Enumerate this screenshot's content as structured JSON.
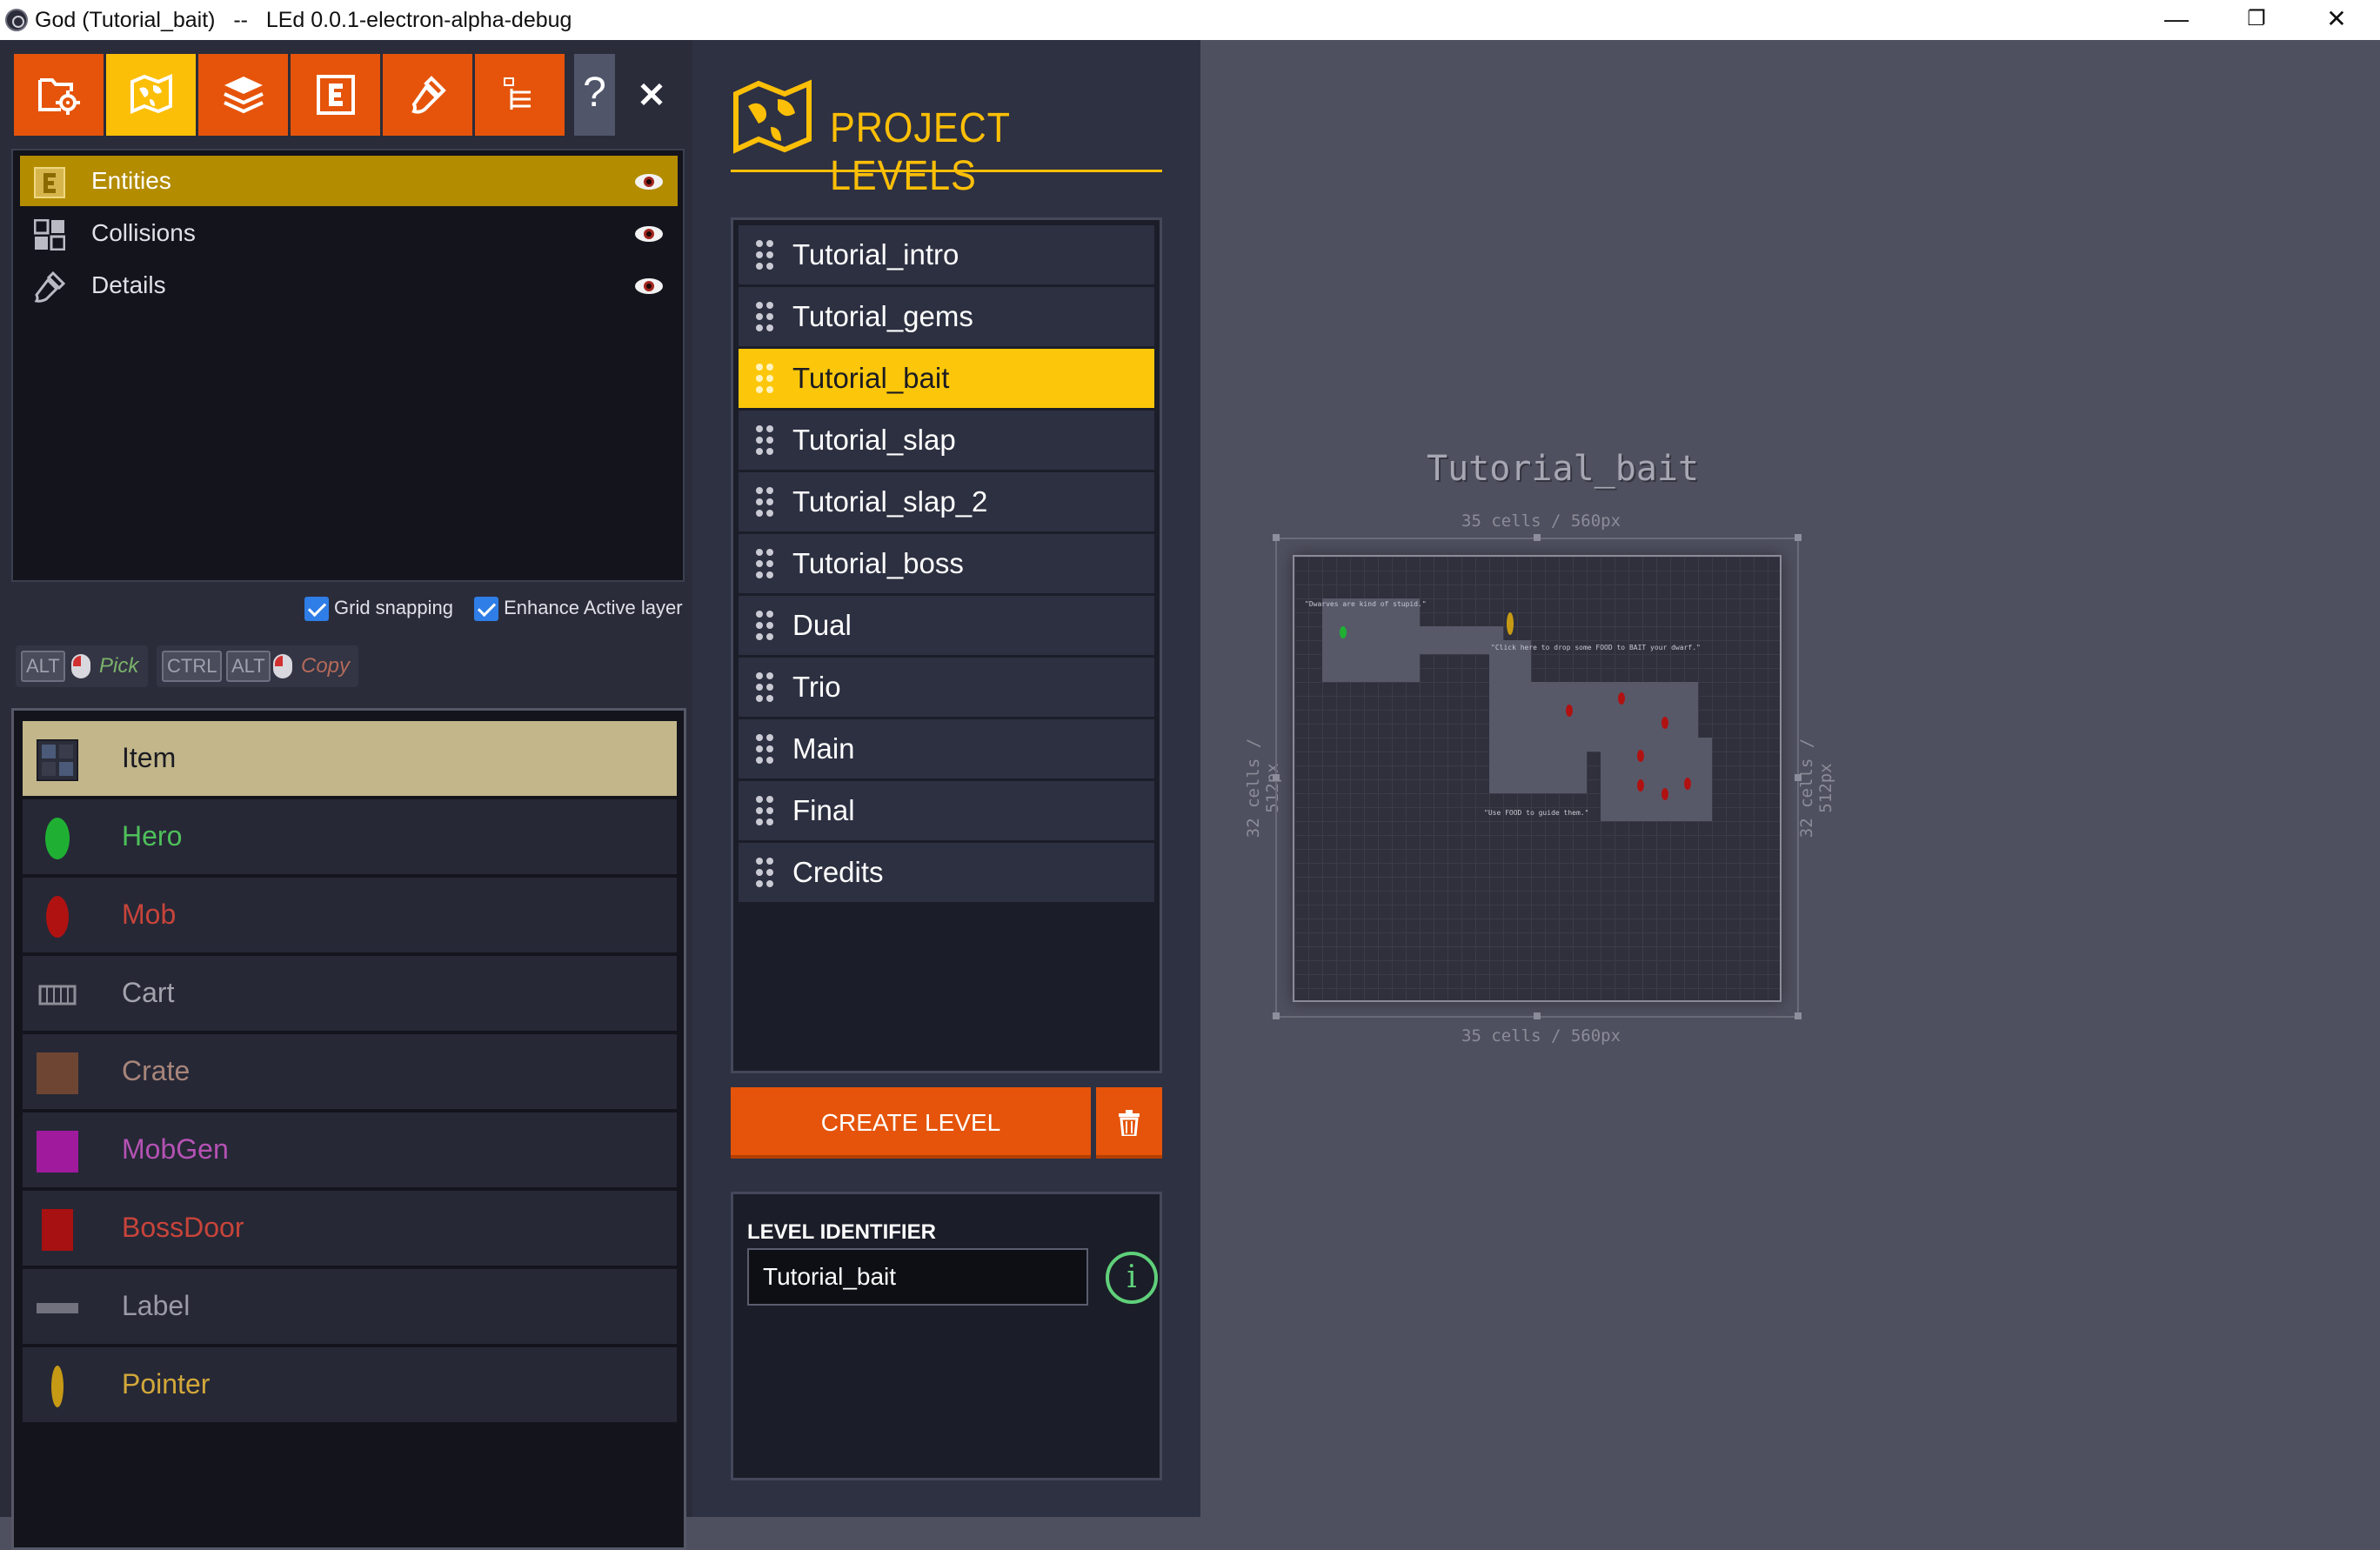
{
  "window": {
    "title": "God (Tutorial_bait)   --   LEd 0.0.1-electron-alpha-debug",
    "controls": [
      "—",
      "❐",
      "✕"
    ]
  },
  "toolbar": {
    "buttons": [
      {
        "name": "project-settings-button",
        "icon": "folder-gear-icon",
        "active": false
      },
      {
        "name": "levels-button",
        "icon": "world-map-icon",
        "active": true
      },
      {
        "name": "layers-button",
        "icon": "layers-stack-icon",
        "active": false
      },
      {
        "name": "entities-button",
        "icon": "entity-e-icon",
        "active": false
      },
      {
        "name": "edit-button",
        "icon": "brush-icon",
        "active": false
      },
      {
        "name": "enums-button",
        "icon": "list-icon",
        "active": false
      }
    ],
    "help_label": "?",
    "close_label": "✕"
  },
  "layers": [
    {
      "name": "Entities",
      "icon": "entity-e-icon",
      "selected": true,
      "visible": true
    },
    {
      "name": "Collisions",
      "icon": "intgrid-icon",
      "selected": false,
      "visible": true
    },
    {
      "name": "Details",
      "icon": "brush-icon",
      "selected": false,
      "visible": true
    }
  ],
  "options": {
    "grid_snapping": {
      "label": "Grid snapping",
      "checked": true
    },
    "enhance_active_layer": {
      "label": "Enhance Active layer",
      "checked": true
    }
  },
  "shortcuts": {
    "alt": "ALT",
    "pick": "Pick",
    "ctrl": "CTRL",
    "alt2": "ALT",
    "copy": "Copy"
  },
  "entities": [
    {
      "name": "Item",
      "color": "#2b2d3a",
      "icon": "item-tileset-icon",
      "selected": true
    },
    {
      "name": "Hero",
      "color": "#1fb033",
      "icon": "green-ellipse-icon",
      "selected": false
    },
    {
      "name": "Mob",
      "color": "#b01212",
      "icon": "red-ellipse-icon",
      "selected": false
    },
    {
      "name": "Cart",
      "color": "#8e8e98",
      "icon": "cart-icon",
      "selected": false
    },
    {
      "name": "Crate",
      "color": "#6e4533",
      "icon": "brown-square-icon",
      "selected": false
    },
    {
      "name": "MobGen",
      "color": "#a01a9e",
      "icon": "purple-square-icon",
      "selected": false
    },
    {
      "name": "BossDoor",
      "color": "#a81111",
      "icon": "red-square-icon",
      "selected": false
    },
    {
      "name": "Label",
      "color": "#71727e",
      "icon": "gray-bar-icon",
      "selected": false
    },
    {
      "name": "Pointer",
      "color": "#c69a15",
      "icon": "yellow-ellipse-icon",
      "selected": false
    }
  ],
  "levels_panel": {
    "title": "PROJECT LEVELS",
    "levels": [
      {
        "name": "Tutorial_intro",
        "selected": false
      },
      {
        "name": "Tutorial_gems",
        "selected": false
      },
      {
        "name": "Tutorial_bait",
        "selected": true
      },
      {
        "name": "Tutorial_slap",
        "selected": false
      },
      {
        "name": "Tutorial_slap_2",
        "selected": false
      },
      {
        "name": "Tutorial_boss",
        "selected": false
      },
      {
        "name": "Dual",
        "selected": false
      },
      {
        "name": "Trio",
        "selected": false
      },
      {
        "name": "Main",
        "selected": false
      },
      {
        "name": "Final",
        "selected": false
      },
      {
        "name": "Credits",
        "selected": false
      }
    ],
    "create_label": "CREATE LEVEL",
    "identifier_label": "LEVEL IDENTIFIER",
    "identifier_value": "Tutorial_bait",
    "info_label": "i"
  },
  "canvas": {
    "level_title": "Tutorial_bait",
    "width_label_top": "35 cells / 560px",
    "width_label_bottom": "35 cells / 560px",
    "height_label_left": "32 cells / 512px",
    "height_label_right": "32 cells / 512px",
    "map_texts": [
      "\"Dwarves are kind of stupid.\"",
      "\"Click here to drop some FOOD to BAIT your dwarf.\"",
      "\"Use FOOD to guide them.\""
    ]
  }
}
